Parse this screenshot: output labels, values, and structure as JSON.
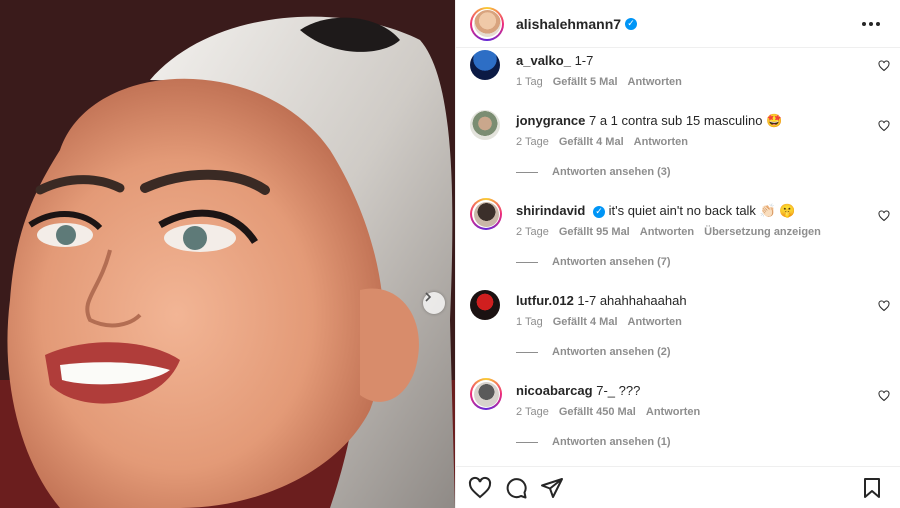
{
  "post": {
    "username": "alishalehmann7",
    "verified": true
  },
  "comments": [
    {
      "username": "a_valko_",
      "text": "1-7",
      "time": "1 Tag",
      "likes": "Gefällt 5 Mal",
      "reply": "Antworten"
    },
    {
      "username": "jonygrance",
      "text": "7 a 1 contra sub 15 masculino 🤩",
      "time": "2 Tage",
      "likes": "Gefällt 4 Mal",
      "reply": "Antworten",
      "view_replies": "Antworten ansehen (3)"
    },
    {
      "username": "shirindavid",
      "verified": true,
      "text": "it's quiet ain't no back talk 👏🏻 🤫",
      "time": "2 Tage",
      "likes": "Gefällt 95 Mal",
      "reply": "Antworten",
      "translate": "Übersetzung anzeigen",
      "view_replies": "Antworten ansehen (7)"
    },
    {
      "username": "lutfur.012",
      "text": "1-7 ahahhahaahah",
      "time": "1 Tag",
      "likes": "Gefällt 4 Mal",
      "reply": "Antworten",
      "view_replies": "Antworten ansehen (2)"
    },
    {
      "username": "nicoabarcag",
      "text": "7-_ ???",
      "time": "2 Tage",
      "likes": "Gefällt 450 Mal",
      "reply": "Antworten",
      "view_replies": "Antworten ansehen (1)"
    }
  ],
  "icons": {
    "header_more": "more-options-icon",
    "like": "heart-icon",
    "comment": "comment-icon",
    "share": "send-icon",
    "save": "bookmark-icon",
    "carousel": "chevron-right-icon"
  },
  "colors": {
    "verified": "#0095f6",
    "meta_text": "#8e8e8e",
    "text": "#262626"
  }
}
